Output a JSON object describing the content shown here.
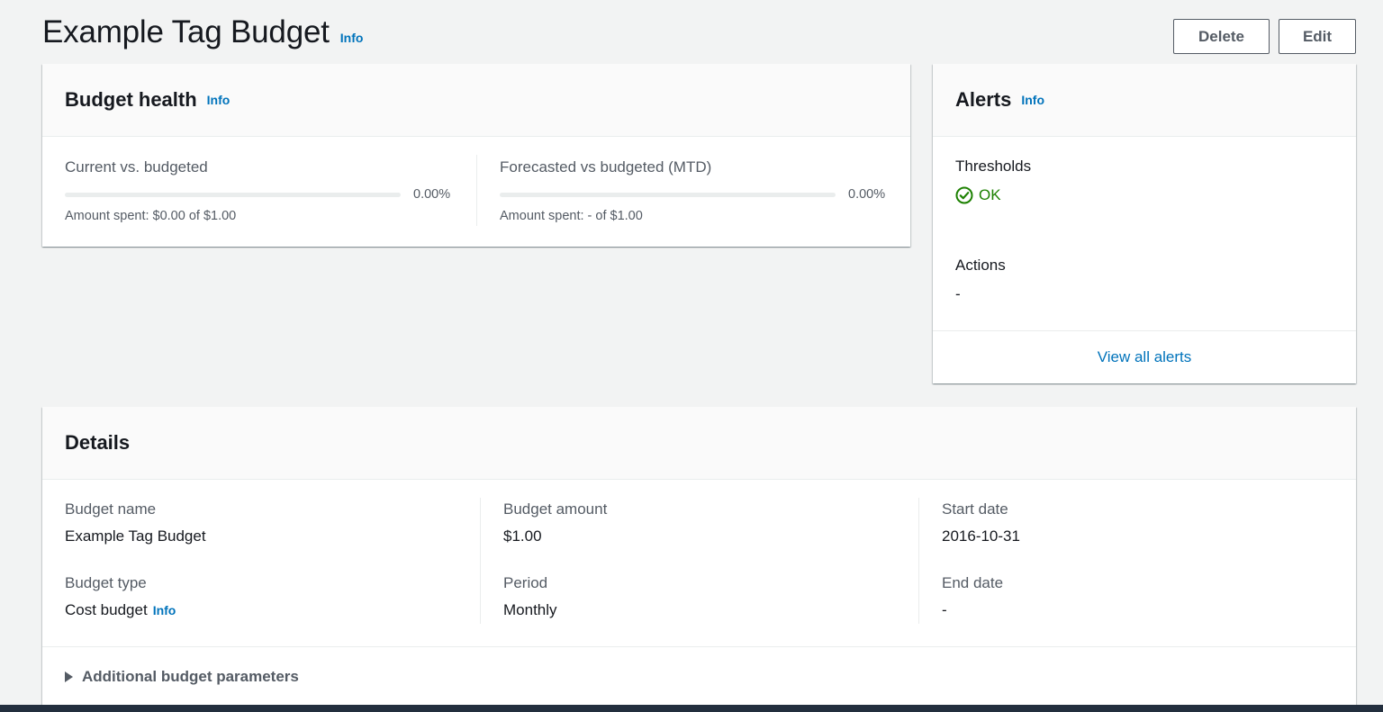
{
  "page": {
    "title": "Example Tag Budget",
    "info_label": "Info",
    "delete_label": "Delete",
    "edit_label": "Edit"
  },
  "budget_health": {
    "title": "Budget health",
    "info_label": "Info",
    "current": {
      "label": "Current vs. budgeted",
      "percent_text": "0.00%",
      "progress_fraction": 0,
      "spent_text": "Amount spent: $0.00 of $1.00"
    },
    "forecasted": {
      "label": "Forecasted vs budgeted (MTD)",
      "percent_text": "0.00%",
      "progress_fraction": 0,
      "spent_text": "Amount spent: - of $1.00"
    }
  },
  "alerts": {
    "title": "Alerts",
    "info_label": "Info",
    "thresholds_label": "Thresholds",
    "thresholds_status": "OK",
    "status_color": "#1d8102",
    "actions_label": "Actions",
    "actions_value": "-",
    "view_all_label": "View all alerts"
  },
  "details": {
    "title": "Details",
    "budget_name_label": "Budget name",
    "budget_name_value": "Example Tag Budget",
    "budget_type_label": "Budget type",
    "budget_type_value": "Cost budget",
    "budget_type_info": "Info",
    "budget_amount_label": "Budget amount",
    "budget_amount_value": "$1.00",
    "period_label": "Period",
    "period_value": "Monthly",
    "start_date_label": "Start date",
    "start_date_value": "2016-10-31",
    "end_date_label": "End date",
    "end_date_value": "-",
    "additional_params_label": "Additional budget parameters"
  },
  "colors": {
    "link": "#0073bb",
    "success": "#1d8102",
    "page_bg": "#f2f3f3",
    "footer_bar": "#232f3e"
  }
}
